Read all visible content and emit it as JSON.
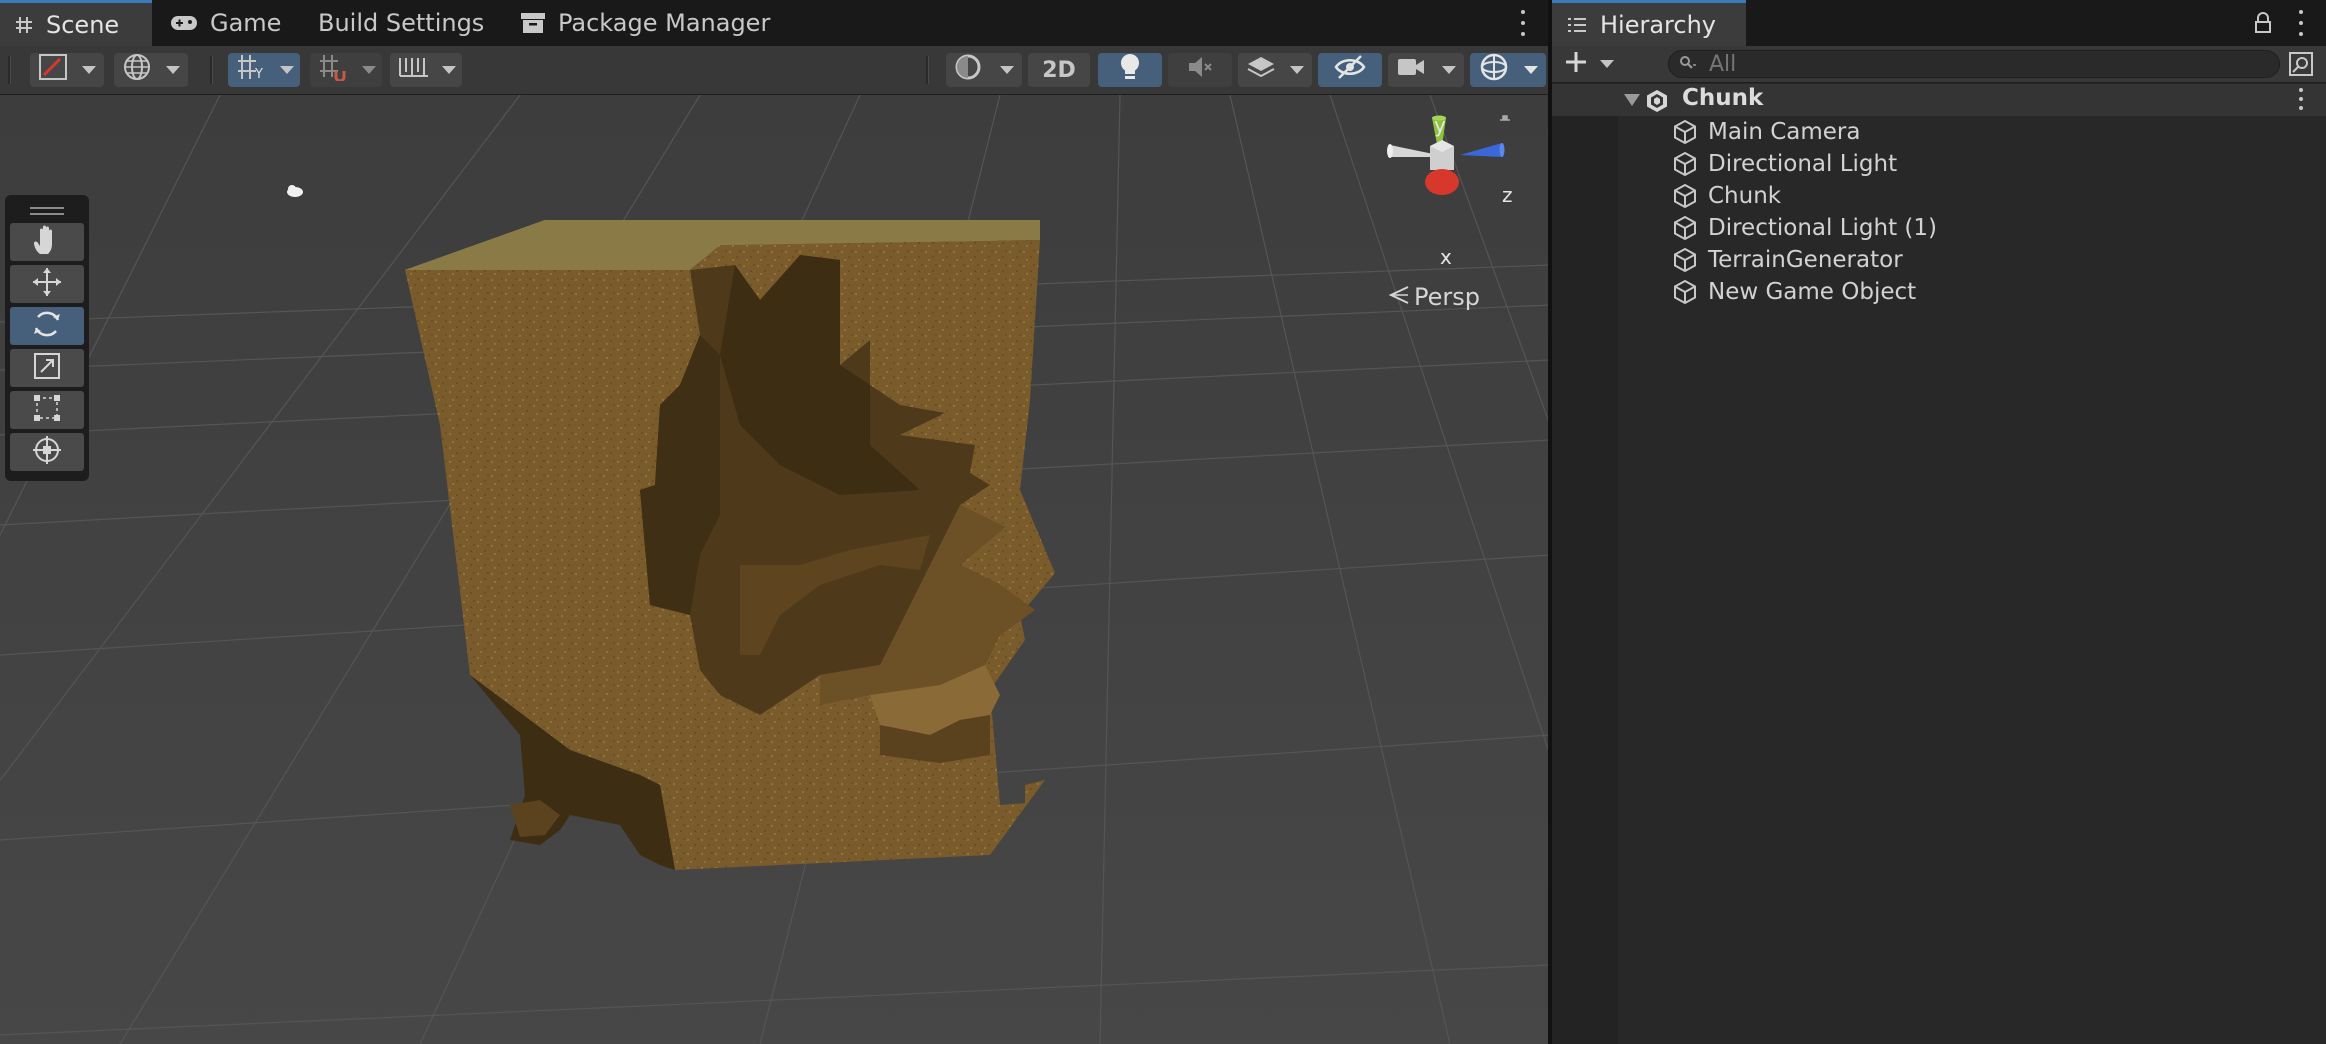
{
  "scene_panel": {
    "tabs": [
      {
        "label": "Scene",
        "icon": "hash-icon",
        "active": true
      },
      {
        "label": "Game",
        "icon": "gamepad-icon",
        "active": false
      },
      {
        "label": "Build Settings",
        "icon": "",
        "active": false
      },
      {
        "label": "Package Manager",
        "icon": "package-icon",
        "active": false
      }
    ],
    "toolbar": {
      "twod_label": "2D"
    },
    "tools": [
      "hand-tool",
      "move-tool",
      "rotate-tool",
      "scale-tool",
      "rect-tool",
      "transform-tool"
    ],
    "active_tool": "rotate-tool",
    "gizmo": {
      "y_label": "y",
      "z_label": "z",
      "x_label": "x",
      "projection_label": "Persp"
    }
  },
  "hierarchy": {
    "title": "Hierarchy",
    "search_placeholder": "All",
    "root": "Chunk",
    "children": [
      "Main Camera",
      "Directional Light",
      "Chunk",
      "Directional Light (1)",
      "TerrainGenerator",
      "New Game Object"
    ]
  },
  "colors": {
    "accent": "#46607c",
    "tab_highlight": "#3a79bb",
    "terrain_dirt": "#7a5b2c",
    "terrain_grass": "#9fa56e",
    "axis_x": "#d8382c",
    "axis_y": "#8bc33b",
    "axis_z": "#3b68d8"
  }
}
